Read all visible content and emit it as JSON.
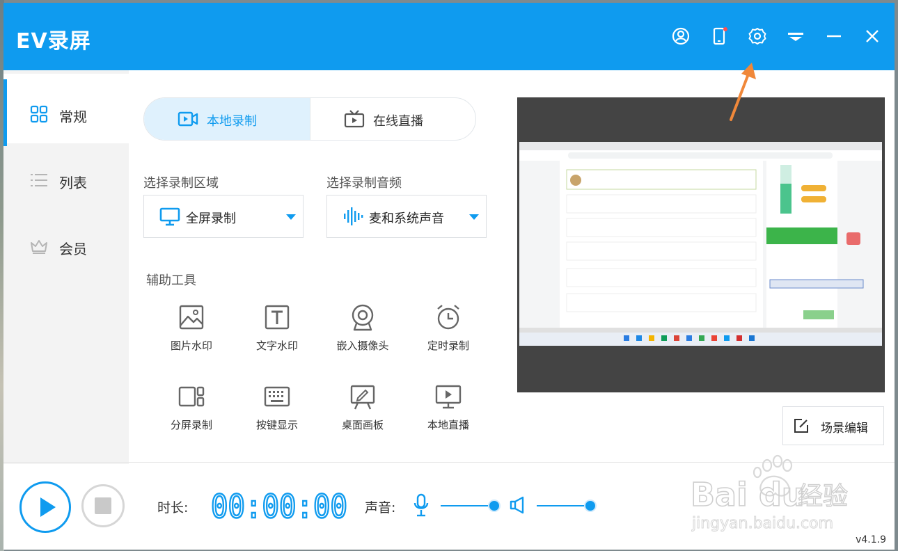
{
  "window": {
    "title": "EV录屏",
    "version": "v4.1.9"
  },
  "titlebar_icons": [
    "user-circle-icon",
    "phone-icon",
    "gear-icon",
    "dropdown-menu-icon",
    "minimize-icon",
    "close-icon"
  ],
  "sidebar": {
    "items": [
      {
        "label": "常规",
        "icon": "grid-icon",
        "active": true
      },
      {
        "label": "列表",
        "icon": "list-icon",
        "active": false
      },
      {
        "label": "会员",
        "icon": "crown-icon",
        "active": false
      }
    ]
  },
  "mode_tabs": [
    {
      "label": "本地录制",
      "icon": "video-camera-icon",
      "active": true
    },
    {
      "label": "在线直播",
      "icon": "tv-play-icon",
      "active": false
    }
  ],
  "record_area": {
    "label": "选择录制区域",
    "value": "全屏录制",
    "icon": "monitor-icon"
  },
  "record_audio": {
    "label": "选择录制音频",
    "value": "麦和系统声音",
    "icon": "audio-wave-icon"
  },
  "tools": {
    "label": "辅助工具",
    "items": [
      {
        "label": "图片水印",
        "icon": "image-icon"
      },
      {
        "label": "文字水印",
        "icon": "text-icon"
      },
      {
        "label": "嵌入摄像头",
        "icon": "webcam-icon"
      },
      {
        "label": "定时录制",
        "icon": "alarm-clock-icon"
      },
      {
        "label": "分屏录制",
        "icon": "split-screen-icon"
      },
      {
        "label": "按键显示",
        "icon": "keyboard-icon"
      },
      {
        "label": "桌面画板",
        "icon": "easel-icon"
      },
      {
        "label": "本地直播",
        "icon": "monitor-play-icon"
      }
    ]
  },
  "scene_edit": {
    "label": "场景编辑"
  },
  "bottom": {
    "duration_label": "时长:",
    "timer": "00:00:00",
    "sound_label": "声音:",
    "mic_volume": 1.0,
    "speaker_volume": 1.0
  },
  "watermark": {
    "brand": "Baidu经验",
    "url": "jingyan.baidu.com"
  },
  "colors": {
    "accent": "#0f9bef",
    "arrow": "#f0883a"
  }
}
